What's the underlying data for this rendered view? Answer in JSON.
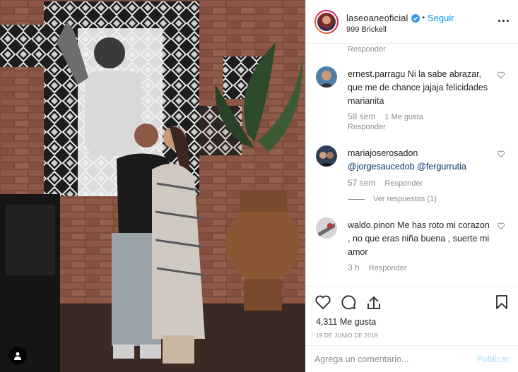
{
  "post": {
    "username": "laseoaneoficial",
    "follow_label": "Seguir",
    "separator": "•",
    "location": "999 Brickell",
    "likes": "4,311 Me gusta",
    "date": "19 DE JUNIO DE 2018"
  },
  "comments": {
    "previous_reply_label": "Responder",
    "items": [
      {
        "user": "ernest.parragu",
        "text": "Ni la sabe abrazar, que me de chance jajaja felicidades marianita",
        "time": "58 sem",
        "likes": "1 Me gusta",
        "reply": "Responder"
      },
      {
        "user": "mariajoserosadon",
        "mention1": "@jorgesaucedob",
        "mention2": "@fergurrutia",
        "time": "57 sem",
        "reply": "Responder",
        "view_replies": "Ver respuestas (1)"
      },
      {
        "user": "waldo.pinon",
        "text": "Me has roto mi corazon , no que eras niña buena , suerte mi amor",
        "time": "3 h",
        "reply": "Responder"
      }
    ]
  },
  "composer": {
    "placeholder": "Agrega un comentario...",
    "publish_label": "Publicar"
  },
  "icons": {
    "verified": "verified-badge-icon",
    "more": "more-options-icon",
    "like": "heart-icon",
    "comment": "comment-bubble-icon",
    "share": "share-arrow-icon",
    "save": "bookmark-icon",
    "user_tag": "user-tag-icon"
  },
  "colors": {
    "accent": "#0095f6",
    "text": "#262626",
    "secondary": "#8e8e8e",
    "publish_disabled": "#b2dffc"
  }
}
